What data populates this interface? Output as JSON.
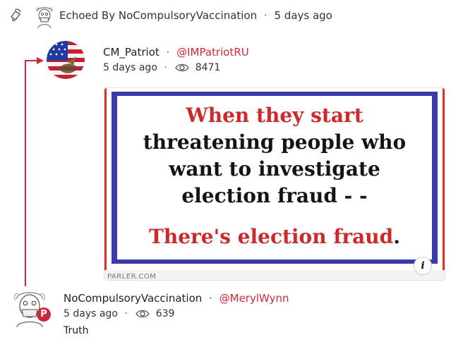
{
  "echo": {
    "label": "Echoed By NoCompulsoryVaccination",
    "separator": "·",
    "time": "5 days ago"
  },
  "top_post": {
    "name": "CM_Patriot",
    "separator": "·",
    "handle": "@IMPatriotRU",
    "time": "5 days ago",
    "meta_separator": "·",
    "views": "8471",
    "card": {
      "line1": "When they start",
      "line2": "threatening people who",
      "line3": "want to investigate",
      "line4": "election fraud - -",
      "line5": "There's election fraud",
      "line5_end": ".",
      "domain": "PARLER.COM",
      "info_glyph": "i"
    }
  },
  "bottom_post": {
    "name": "NoCompulsoryVaccination",
    "separator": "·",
    "handle": "@MerylWynn",
    "time": "5 days ago",
    "meta_separator": "·",
    "views": "639",
    "body": "Truth",
    "badge_glyph": "P"
  },
  "colors": {
    "accent_red": "#d1283a",
    "thread_line": "#c8283a",
    "meme_blue": "#3a3aa8"
  },
  "icons": [
    "echo-icon",
    "eye-icon",
    "info-icon",
    "parler-badge-icon",
    "arrow-icon"
  ]
}
